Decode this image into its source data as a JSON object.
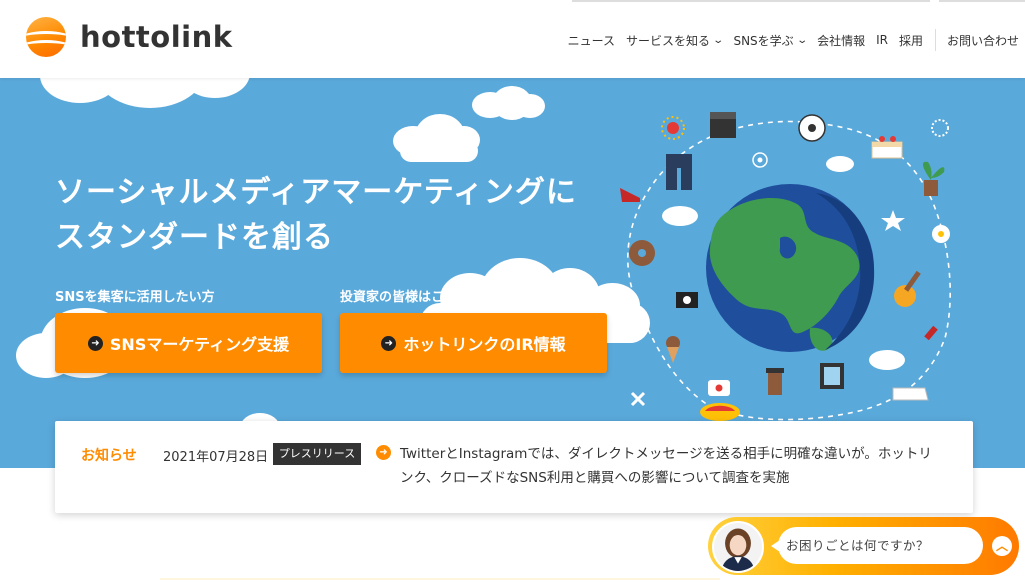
{
  "header": {
    "logo_text": "hottolink",
    "nav": {
      "news": "ニュース",
      "services": "サービスを知る",
      "sns_learn": "SNSを学ぶ",
      "company": "会社情報",
      "ir": "IR",
      "recruit": "採用",
      "contact": "お問い合わせ"
    }
  },
  "hero": {
    "title_line1": "ソーシャルメディアマーケティングに",
    "title_line2": "スタンダードを創る",
    "cta1": {
      "label": "SNSを集客に活用したい方",
      "button": "SNSマーケティング支援"
    },
    "cta2": {
      "label": "投資家の皆様はこちらから",
      "button": "ホットリンクのIR情報"
    }
  },
  "news": {
    "heading": "お知らせ",
    "date": "2021年07月28日",
    "category": "プレスリリース",
    "text": "TwitterとInstagramでは、ダイレクトメッセージを送る相手に明確な違いが。ホットリンク、クローズドなSNS利用と購買への影響について調査を実施"
  },
  "chat": {
    "message": "お困りごとは何ですか？"
  },
  "colors": {
    "accent": "#ff8c00",
    "hero_bg": "#5aa9db",
    "text": "#333333"
  },
  "icons": {
    "cta_arrow": "arrow-right-circle-icon",
    "news_arrow": "arrow-right-circle-icon",
    "chat_toggle": "chevron-up-icon",
    "nav_dropdown": "chevron-down-icon"
  }
}
